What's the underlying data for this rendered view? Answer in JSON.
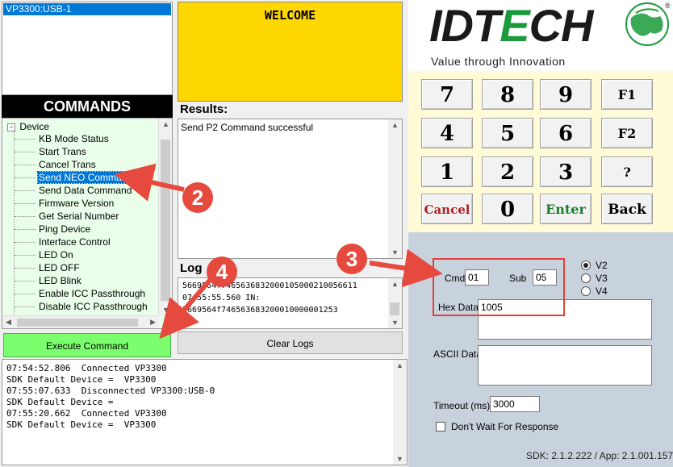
{
  "device_list": {
    "selected": "VP3300:USB-1"
  },
  "commands_header": "COMMANDS",
  "tree": {
    "root": "Device",
    "items": [
      "KB Mode Status",
      "Start Trans",
      "Cancel Trans",
      "Send NEO Command",
      "Send Data Command",
      "Firmware Version",
      "Get Serial Number",
      "Ping Device",
      "Interface Control",
      "LED On",
      "LED OFF",
      "LED Blink",
      "Enable ICC Passthrough",
      "Disable ICC Passthrough"
    ],
    "selected_index": 3
  },
  "execute_label": "Execute Command",
  "welcome": "WELCOME",
  "results": {
    "label": "Results:",
    "text": "Send P2 Command successful"
  },
  "logs": {
    "label": "Log",
    "lines": [
      "5669564f7465636832000105000210056611",
      "07:55:55.560   IN:",
      "5669564f746563683200010000001253"
    ]
  },
  "clear_logs_label": "Clear Logs",
  "console_lines": [
    "07:54:52.806  Connected VP3300",
    "SDK Default Device =  VP3300",
    "07:55:07.633  Disconnected VP3300:USB-0",
    "SDK Default Device =",
    "07:55:20.662  Connected VP3300",
    "SDK Default Device =  VP3300"
  ],
  "logo": {
    "id_part": "IDT",
    "e_part": "E",
    "ch_part": "CH",
    "registered": "®",
    "tagline": "Value through Innovation"
  },
  "keypad": {
    "keys": [
      "7",
      "8",
      "9",
      "F1",
      "4",
      "5",
      "6",
      "F2",
      "1",
      "2",
      "3",
      "?",
      "Cancel",
      "0",
      "Enter",
      "Back"
    ]
  },
  "cmd_form": {
    "cmd_label": "Cmd",
    "cmd_value": "01",
    "sub_label": "Sub",
    "sub_value": "05",
    "hex_label": "Hex Data",
    "hex_value": "1005",
    "ascii_label": "ASCII Data",
    "ascii_value": "",
    "timeout_label": "Timeout (ms)",
    "timeout_value": "3000",
    "dont_wait_label": "Don't Wait For Response",
    "versions": [
      "V2",
      "V3",
      "V4"
    ],
    "selected_version": "V2"
  },
  "sdk_version": "SDK: 2.1.2.222  /  App: 2.1.001.157",
  "annotations": {
    "badge2": "2",
    "badge3": "3",
    "badge4": "4"
  },
  "colors": {
    "annotation_red": "#e64a3f",
    "execute_green": "#7cff6e",
    "welcome_yellow": "#ffd700",
    "tree_bg": "#eaffea",
    "keypad_bg": "#fffbd6",
    "panel_bg": "#c8d2dd"
  }
}
